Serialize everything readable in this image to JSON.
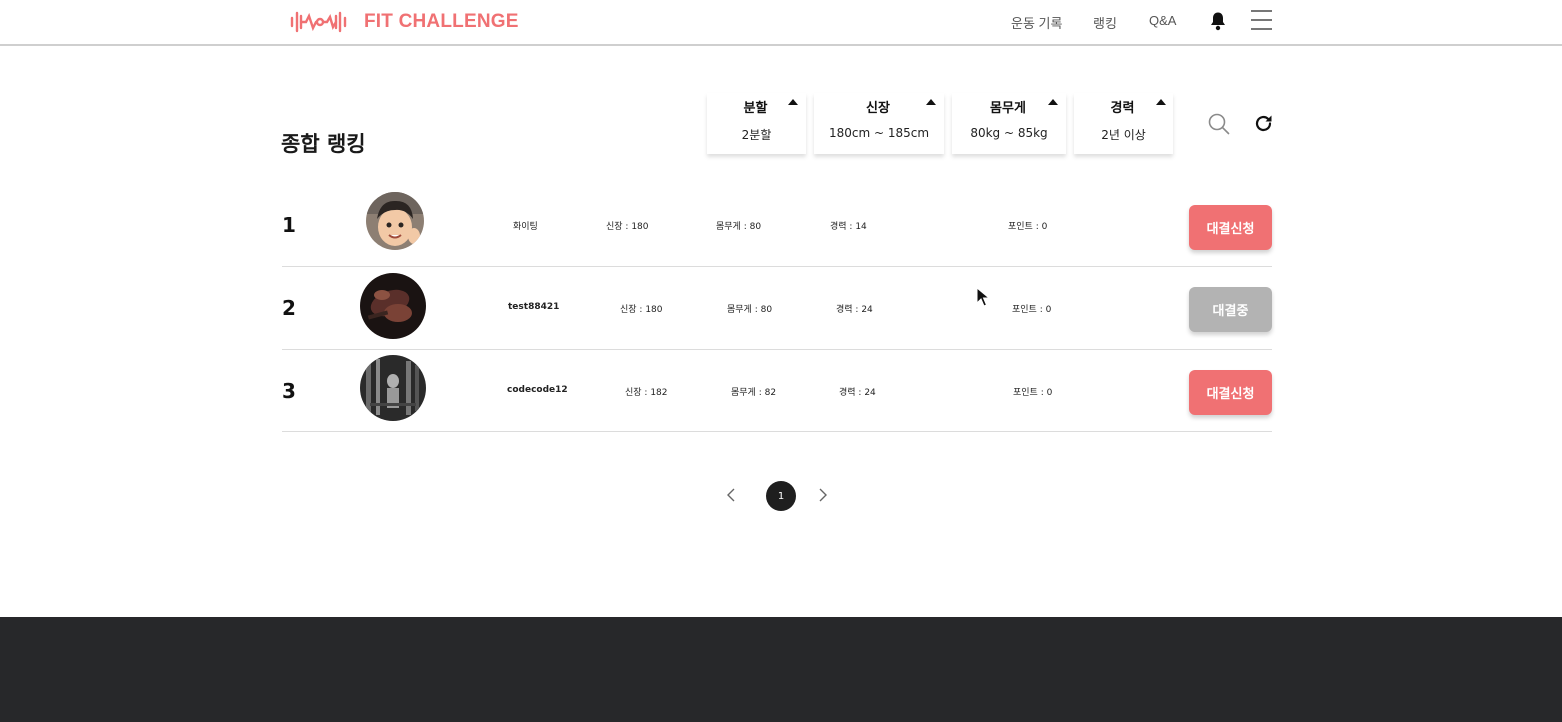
{
  "brand": {
    "name": "FIT CHALLENGE",
    "color": "#f07173",
    "logo_icon": "dumbbell-heartbeat-icon"
  },
  "nav": {
    "items": [
      {
        "label": "운동 기록"
      },
      {
        "label": "랭킹"
      },
      {
        "label": "Q&A"
      }
    ],
    "bell_icon": "bell-icon",
    "menu_icon": "hamburger-menu-icon"
  },
  "page": {
    "title": "종합 랭킹"
  },
  "filters": [
    {
      "label": "분할",
      "value": "2분할"
    },
    {
      "label": "신장",
      "value": "180cm ~ 185cm"
    },
    {
      "label": "몸무게",
      "value": "80kg ~ 85kg"
    },
    {
      "label": "경력",
      "value": "2년 이상"
    }
  ],
  "toolbar": {
    "search_icon": "search-icon",
    "refresh_icon": "refresh-icon"
  },
  "rankings": [
    {
      "rank": "1",
      "name": "화이팅",
      "height": "신장 : 180",
      "weight": "몸무게 : 80",
      "career": "경력 : 14",
      "points": "포인트 : 0",
      "action": "대결신청",
      "action_color": "#f07173"
    },
    {
      "rank": "2",
      "name": "test88421",
      "height": "신장 : 180",
      "weight": "몸무게 : 80",
      "career": "경력 : 24",
      "points": "포인트 : 0",
      "action": "대결중",
      "action_color": "#b3b3b3"
    },
    {
      "rank": "3",
      "name": "codecode12",
      "height": "신장 : 182",
      "weight": "몸무게 : 82",
      "career": "경력 : 24",
      "points": "포인트 : 0",
      "action": "대결신청",
      "action_color": "#f07173"
    }
  ],
  "pagination": {
    "current": "1",
    "prev_icon": "chevron-left-icon",
    "next_icon": "chevron-right-icon"
  },
  "colors": {
    "accent": "#f07173",
    "disabled": "#b3b3b3",
    "footer": "#27282a"
  }
}
